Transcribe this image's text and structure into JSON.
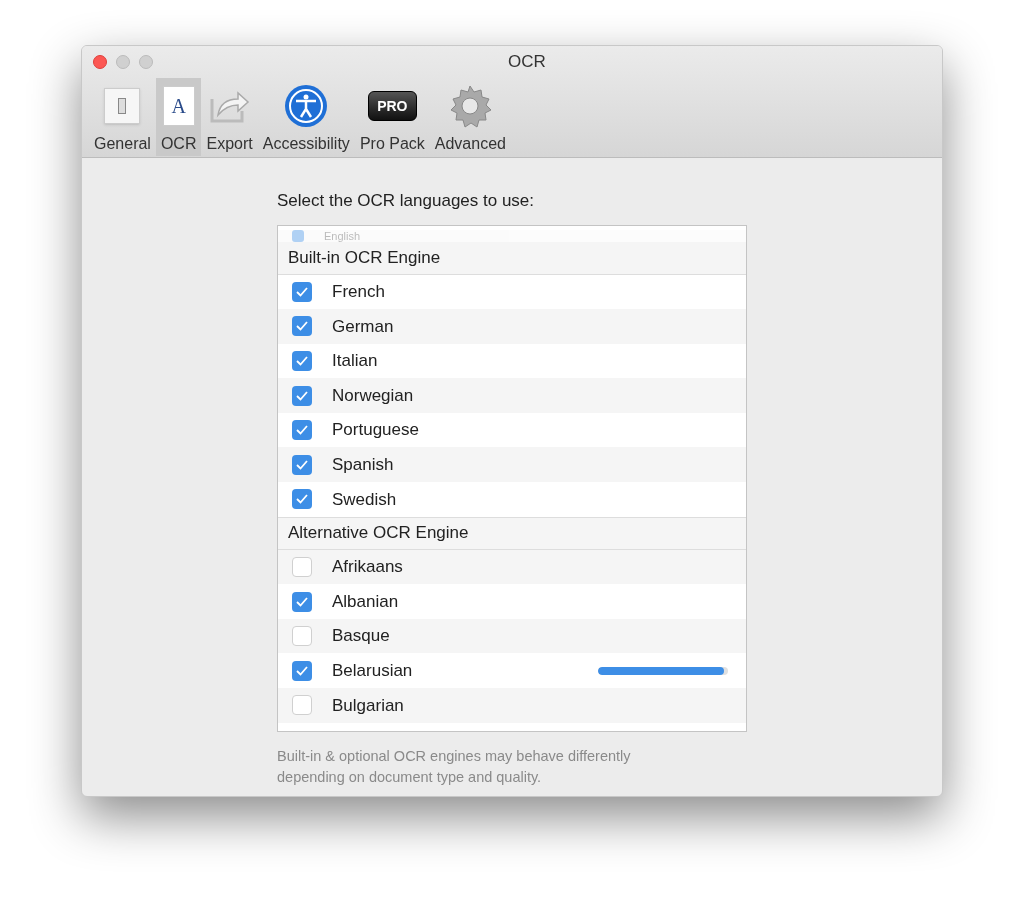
{
  "window": {
    "title": "OCR"
  },
  "toolbar": [
    {
      "kind": "general",
      "label": "General",
      "selected": false
    },
    {
      "kind": "ocr",
      "label": "OCR",
      "icon_text": "A",
      "selected": true
    },
    {
      "kind": "export",
      "label": "Export",
      "selected": false
    },
    {
      "kind": "accessibility",
      "label": "Accessibility",
      "selected": false
    },
    {
      "kind": "pro",
      "label": "Pro Pack",
      "icon_text": "PRO",
      "selected": false
    },
    {
      "kind": "advanced",
      "label": "Advanced",
      "selected": false
    }
  ],
  "prompt": "Select the OCR languages to use:",
  "scrolled_past": {
    "label": "English",
    "checked": true
  },
  "groups": [
    {
      "title": "Built-in OCR Engine",
      "languages": [
        {
          "label": "French",
          "checked": true
        },
        {
          "label": "German",
          "checked": true
        },
        {
          "label": "Italian",
          "checked": true
        },
        {
          "label": "Norwegian",
          "checked": true
        },
        {
          "label": "Portuguese",
          "checked": true
        },
        {
          "label": "Spanish",
          "checked": true
        },
        {
          "label": "Swedish",
          "checked": true
        }
      ]
    },
    {
      "title": "Alternative OCR Engine",
      "languages": [
        {
          "label": "Afrikaans",
          "checked": false
        },
        {
          "label": "Albanian",
          "checked": true
        },
        {
          "label": "Basque",
          "checked": false
        },
        {
          "label": "Belarusian",
          "checked": true,
          "level": 0.97
        },
        {
          "label": "Bulgarian",
          "checked": false
        }
      ]
    }
  ],
  "note": "Built-in & optional OCR engines may behave differently depending on document type and quality."
}
